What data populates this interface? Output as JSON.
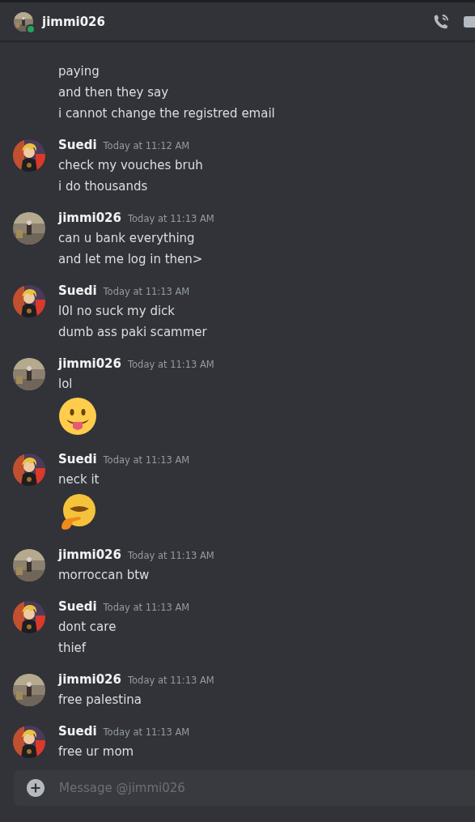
{
  "header": {
    "name": "jimmi026",
    "online": true
  },
  "messages": [
    {
      "kind": "continuation",
      "lines": [
        {
          "kind": "text",
          "text": "paying"
        },
        {
          "kind": "text",
          "text": "and then they say"
        },
        {
          "kind": "text",
          "text": "i cannot change the registred email"
        }
      ]
    },
    {
      "kind": "group",
      "author": "Suedi",
      "own": true,
      "time": "Today at 11:12 AM",
      "lines": [
        {
          "kind": "text",
          "text": "check my vouches bruh"
        },
        {
          "kind": "text",
          "text": "i do thousands"
        }
      ]
    },
    {
      "kind": "group",
      "author": "jimmi026",
      "own": false,
      "time": "Today at 11:13 AM",
      "lines": [
        {
          "kind": "text",
          "text": "can u bank everything"
        },
        {
          "kind": "text",
          "text": "and let me log in then>"
        }
      ]
    },
    {
      "kind": "group",
      "author": "Suedi",
      "own": true,
      "time": "Today at 11:13 AM",
      "lines": [
        {
          "kind": "text",
          "text": "l0l no suck my dick"
        },
        {
          "kind": "text",
          "text": "dumb ass paki scammer"
        }
      ]
    },
    {
      "kind": "group",
      "author": "jimmi026",
      "own": false,
      "time": "Today at 11:13 AM",
      "lines": [
        {
          "kind": "text",
          "text": "lol"
        },
        {
          "kind": "emoji",
          "custom": false
        }
      ]
    },
    {
      "kind": "group",
      "author": "Suedi",
      "own": true,
      "time": "Today at 11:13 AM",
      "lines": [
        {
          "kind": "text",
          "text": "neck it"
        },
        {
          "kind": "emoji",
          "custom": true
        }
      ]
    },
    {
      "kind": "group",
      "author": "jimmi026",
      "own": false,
      "time": "Today at 11:13 AM",
      "lines": [
        {
          "kind": "text",
          "text": "morroccan btw"
        }
      ]
    },
    {
      "kind": "group",
      "author": "Suedi",
      "own": true,
      "time": "Today at 11:13 AM",
      "lines": [
        {
          "kind": "text",
          "text": "dont care"
        },
        {
          "kind": "text",
          "text": "thief"
        }
      ]
    },
    {
      "kind": "group",
      "author": "jimmi026",
      "own": false,
      "time": "Today at 11:13 AM",
      "lines": [
        {
          "kind": "text",
          "text": "free palestina"
        }
      ]
    },
    {
      "kind": "group",
      "author": "Suedi",
      "own": true,
      "time": "Today at 11:13 AM",
      "lines": [
        {
          "kind": "text",
          "text": "free ur mom"
        }
      ]
    }
  ],
  "composer": {
    "placeholder": "Message @jimmi026"
  }
}
